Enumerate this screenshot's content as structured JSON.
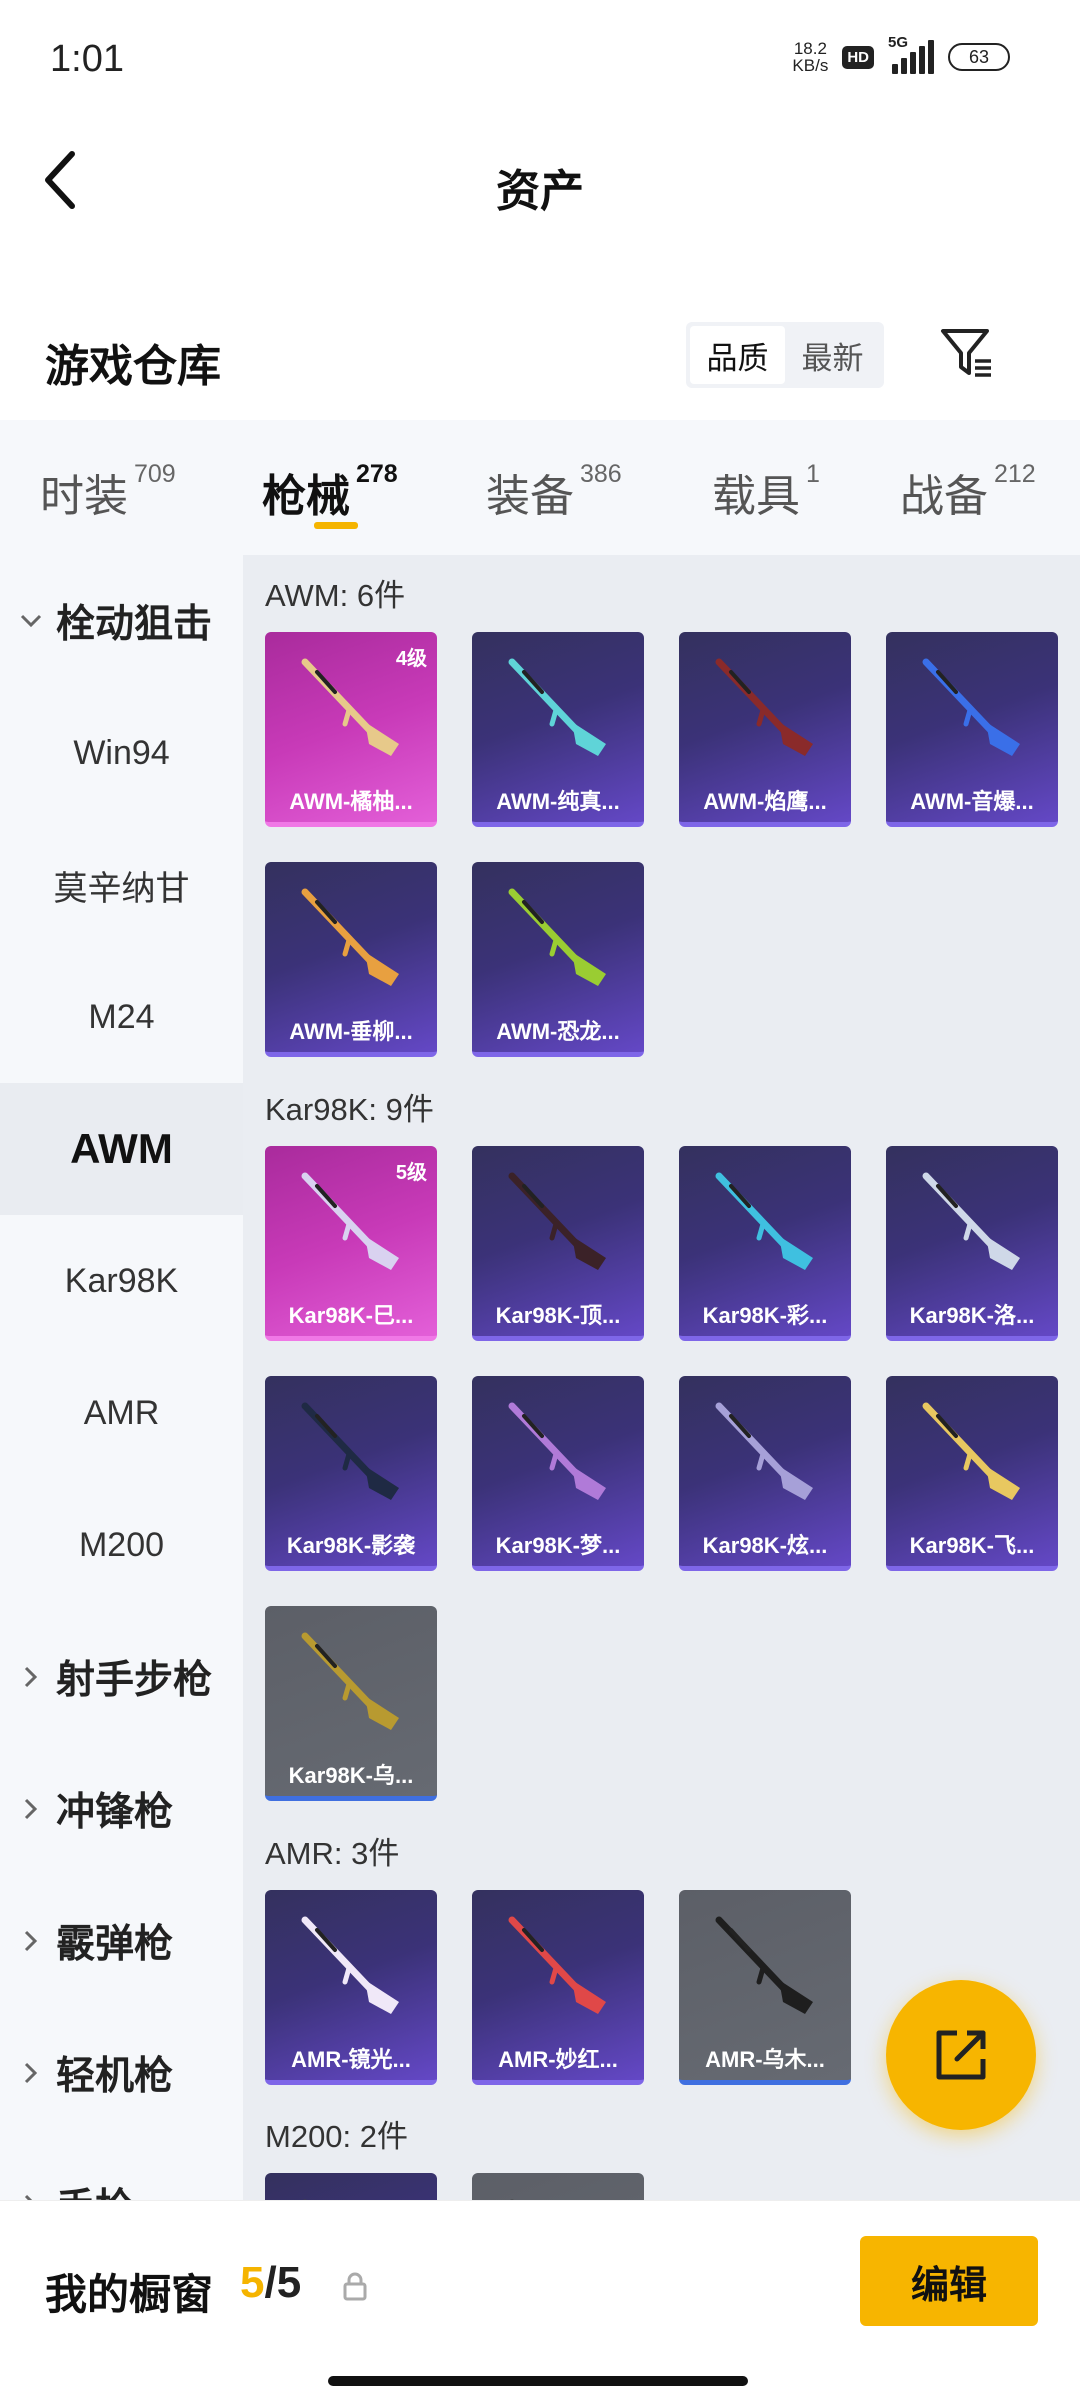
{
  "status": {
    "time": "1:01",
    "speed_value": "18.2",
    "speed_unit": "KB/s",
    "hd": "HD",
    "network": "5G",
    "battery": "63"
  },
  "header": {
    "title": "资产",
    "back_icon": "chevron-left-icon"
  },
  "warehouse": {
    "title": "游戏仓库",
    "sort_options": [
      "品质",
      "最新"
    ],
    "sort_selected": "品质",
    "filter_icon": "filter-icon"
  },
  "tabs": [
    {
      "label": "时装",
      "count": "709"
    },
    {
      "label": "枪械",
      "count": "278"
    },
    {
      "label": "装备",
      "count": "386"
    },
    {
      "label": "载具",
      "count": "1"
    },
    {
      "label": "战备",
      "count": "212"
    }
  ],
  "active_tab": "枪械",
  "accent_color": "#f5b400",
  "sidenav": [
    {
      "label": "栓动狙击",
      "type": "group",
      "expanded": true
    },
    {
      "label": "Win94",
      "type": "item"
    },
    {
      "label": "莫辛纳甘",
      "type": "item"
    },
    {
      "label": "M24",
      "type": "item"
    },
    {
      "label": "AWM",
      "type": "item",
      "active": true
    },
    {
      "label": "Kar98K",
      "type": "item"
    },
    {
      "label": "AMR",
      "type": "item"
    },
    {
      "label": "M200",
      "type": "item"
    },
    {
      "label": "射手步枪",
      "type": "group",
      "expanded": false
    },
    {
      "label": "冲锋枪",
      "type": "group",
      "expanded": false
    },
    {
      "label": "霰弹枪",
      "type": "group",
      "expanded": false
    },
    {
      "label": "轻机枪",
      "type": "group",
      "expanded": false
    },
    {
      "label": "手枪",
      "type": "group",
      "expanded": false
    }
  ],
  "sections": [
    {
      "title": "AWM: 6件",
      "items": [
        {
          "name": "AWM-橘柚...",
          "rarity": "pink",
          "level": "4级",
          "gun_color": "#e7c98a"
        },
        {
          "name": "AWM-纯真...",
          "rarity": "purple",
          "gun_color": "#5fd4d8"
        },
        {
          "name": "AWM-焰鹰...",
          "rarity": "purple",
          "gun_color": "#8a2a2a"
        },
        {
          "name": "AWM-音爆...",
          "rarity": "purple",
          "gun_color": "#3a6fe8"
        },
        {
          "name": "AWM-垂柳...",
          "rarity": "purple",
          "gun_color": "#e8a040"
        },
        {
          "name": "AWM-恐龙...",
          "rarity": "purple",
          "gun_color": "#9acd32"
        }
      ]
    },
    {
      "title": "Kar98K: 9件",
      "items": [
        {
          "name": "Kar98K-巳...",
          "rarity": "pink",
          "level": "5级",
          "gun_color": "#d9d2f0"
        },
        {
          "name": "Kar98K-顶...",
          "rarity": "purple",
          "gun_color": "#3b2228"
        },
        {
          "name": "Kar98K-彩...",
          "rarity": "purple",
          "gun_color": "#3fc0e0"
        },
        {
          "name": "Kar98K-洛...",
          "rarity": "purple",
          "gun_color": "#cfd8e8"
        },
        {
          "name": "Kar98K-影袭",
          "rarity": "purple",
          "gun_color": "#1f2a44"
        },
        {
          "name": "Kar98K-梦...",
          "rarity": "purple",
          "gun_color": "#b07ad8"
        },
        {
          "name": "Kar98K-炫...",
          "rarity": "purple",
          "gun_color": "#a6a0d8"
        },
        {
          "name": "Kar98K-飞...",
          "rarity": "purple",
          "gun_color": "#e8c860"
        },
        {
          "name": "Kar98K-乌...",
          "rarity": "gray",
          "gun_color": "#b89a30"
        }
      ]
    },
    {
      "title": "AMR: 3件",
      "items": [
        {
          "name": "AMR-镜光...",
          "rarity": "purple",
          "gun_color": "#f0e8f8"
        },
        {
          "name": "AMR-妙红...",
          "rarity": "purple",
          "gun_color": "#e04848"
        },
        {
          "name": "AMR-乌木...",
          "rarity": "gray",
          "gun_color": "#1e1e1e"
        }
      ]
    },
    {
      "title": "M200: 2件",
      "items": [
        {
          "name": "",
          "rarity": "purple",
          "gun_color": "#444"
        },
        {
          "name": "",
          "rarity": "gray",
          "gun_color": "#444"
        }
      ]
    }
  ],
  "fab_icon": "share-icon",
  "bottom": {
    "label": "我的橱窗",
    "current": "5",
    "total": "/5",
    "lock_icon": "lock-icon",
    "edit_label": "编辑"
  }
}
